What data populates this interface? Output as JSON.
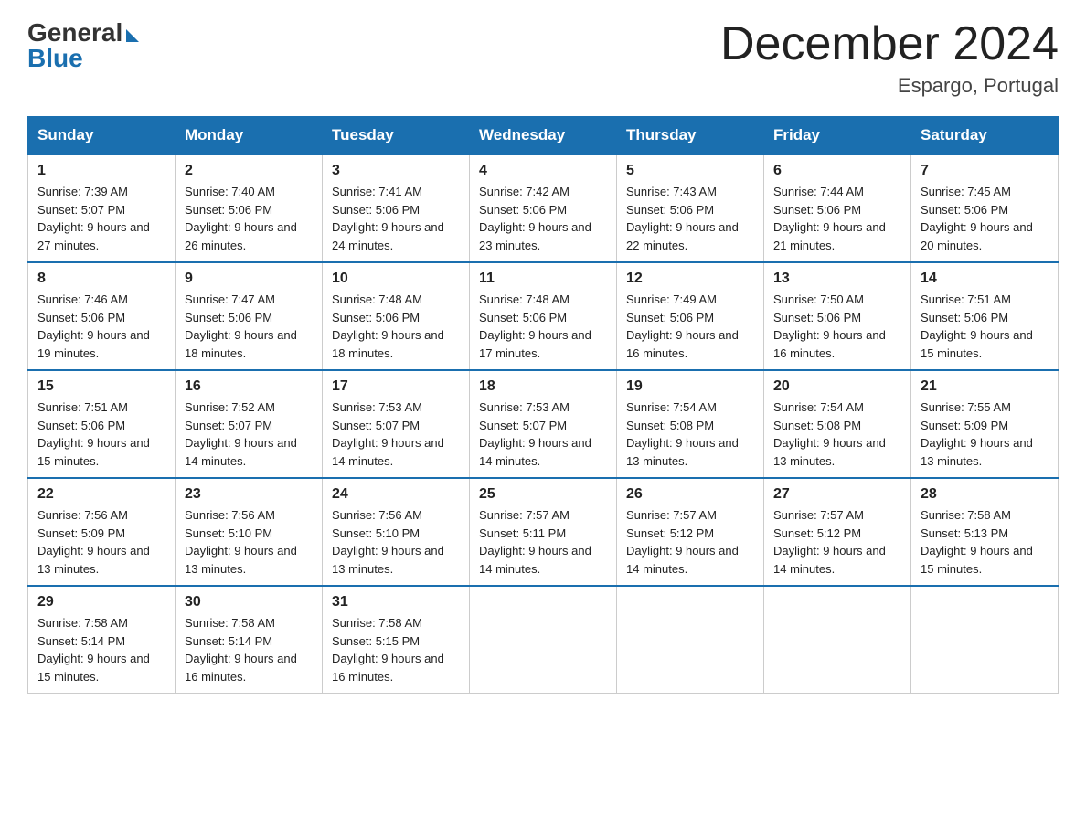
{
  "header": {
    "logo_general": "General",
    "logo_blue": "Blue",
    "month_year": "December 2024",
    "location": "Espargo, Portugal"
  },
  "days_of_week": [
    "Sunday",
    "Monday",
    "Tuesday",
    "Wednesday",
    "Thursday",
    "Friday",
    "Saturday"
  ],
  "weeks": [
    [
      {
        "day": "1",
        "sunrise": "7:39 AM",
        "sunset": "5:07 PM",
        "daylight": "9 hours and 27 minutes."
      },
      {
        "day": "2",
        "sunrise": "7:40 AM",
        "sunset": "5:06 PM",
        "daylight": "9 hours and 26 minutes."
      },
      {
        "day": "3",
        "sunrise": "7:41 AM",
        "sunset": "5:06 PM",
        "daylight": "9 hours and 24 minutes."
      },
      {
        "day": "4",
        "sunrise": "7:42 AM",
        "sunset": "5:06 PM",
        "daylight": "9 hours and 23 minutes."
      },
      {
        "day": "5",
        "sunrise": "7:43 AM",
        "sunset": "5:06 PM",
        "daylight": "9 hours and 22 minutes."
      },
      {
        "day": "6",
        "sunrise": "7:44 AM",
        "sunset": "5:06 PM",
        "daylight": "9 hours and 21 minutes."
      },
      {
        "day": "7",
        "sunrise": "7:45 AM",
        "sunset": "5:06 PM",
        "daylight": "9 hours and 20 minutes."
      }
    ],
    [
      {
        "day": "8",
        "sunrise": "7:46 AM",
        "sunset": "5:06 PM",
        "daylight": "9 hours and 19 minutes."
      },
      {
        "day": "9",
        "sunrise": "7:47 AM",
        "sunset": "5:06 PM",
        "daylight": "9 hours and 18 minutes."
      },
      {
        "day": "10",
        "sunrise": "7:48 AM",
        "sunset": "5:06 PM",
        "daylight": "9 hours and 18 minutes."
      },
      {
        "day": "11",
        "sunrise": "7:48 AM",
        "sunset": "5:06 PM",
        "daylight": "9 hours and 17 minutes."
      },
      {
        "day": "12",
        "sunrise": "7:49 AM",
        "sunset": "5:06 PM",
        "daylight": "9 hours and 16 minutes."
      },
      {
        "day": "13",
        "sunrise": "7:50 AM",
        "sunset": "5:06 PM",
        "daylight": "9 hours and 16 minutes."
      },
      {
        "day": "14",
        "sunrise": "7:51 AM",
        "sunset": "5:06 PM",
        "daylight": "9 hours and 15 minutes."
      }
    ],
    [
      {
        "day": "15",
        "sunrise": "7:51 AM",
        "sunset": "5:06 PM",
        "daylight": "9 hours and 15 minutes."
      },
      {
        "day": "16",
        "sunrise": "7:52 AM",
        "sunset": "5:07 PM",
        "daylight": "9 hours and 14 minutes."
      },
      {
        "day": "17",
        "sunrise": "7:53 AM",
        "sunset": "5:07 PM",
        "daylight": "9 hours and 14 minutes."
      },
      {
        "day": "18",
        "sunrise": "7:53 AM",
        "sunset": "5:07 PM",
        "daylight": "9 hours and 14 minutes."
      },
      {
        "day": "19",
        "sunrise": "7:54 AM",
        "sunset": "5:08 PM",
        "daylight": "9 hours and 13 minutes."
      },
      {
        "day": "20",
        "sunrise": "7:54 AM",
        "sunset": "5:08 PM",
        "daylight": "9 hours and 13 minutes."
      },
      {
        "day": "21",
        "sunrise": "7:55 AM",
        "sunset": "5:09 PM",
        "daylight": "9 hours and 13 minutes."
      }
    ],
    [
      {
        "day": "22",
        "sunrise": "7:56 AM",
        "sunset": "5:09 PM",
        "daylight": "9 hours and 13 minutes."
      },
      {
        "day": "23",
        "sunrise": "7:56 AM",
        "sunset": "5:10 PM",
        "daylight": "9 hours and 13 minutes."
      },
      {
        "day": "24",
        "sunrise": "7:56 AM",
        "sunset": "5:10 PM",
        "daylight": "9 hours and 13 minutes."
      },
      {
        "day": "25",
        "sunrise": "7:57 AM",
        "sunset": "5:11 PM",
        "daylight": "9 hours and 14 minutes."
      },
      {
        "day": "26",
        "sunrise": "7:57 AM",
        "sunset": "5:12 PM",
        "daylight": "9 hours and 14 minutes."
      },
      {
        "day": "27",
        "sunrise": "7:57 AM",
        "sunset": "5:12 PM",
        "daylight": "9 hours and 14 minutes."
      },
      {
        "day": "28",
        "sunrise": "7:58 AM",
        "sunset": "5:13 PM",
        "daylight": "9 hours and 15 minutes."
      }
    ],
    [
      {
        "day": "29",
        "sunrise": "7:58 AM",
        "sunset": "5:14 PM",
        "daylight": "9 hours and 15 minutes."
      },
      {
        "day": "30",
        "sunrise": "7:58 AM",
        "sunset": "5:14 PM",
        "daylight": "9 hours and 16 minutes."
      },
      {
        "day": "31",
        "sunrise": "7:58 AM",
        "sunset": "5:15 PM",
        "daylight": "9 hours and 16 minutes."
      },
      null,
      null,
      null,
      null
    ]
  ]
}
